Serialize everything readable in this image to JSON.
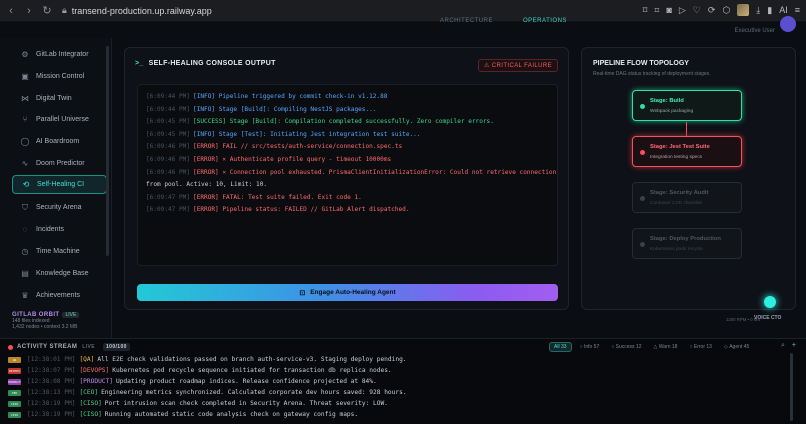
{
  "browser": {
    "url": "transend-production.up.railway.app",
    "ai_label": "AI"
  },
  "app_top": {
    "tabs": [
      "ARCHITECTURE",
      "OPERATIONS"
    ],
    "user_name": "Executive User"
  },
  "sidebar": {
    "items": [
      {
        "label": "GitLab Integrator",
        "icon": "grid-icon"
      },
      {
        "label": "Mission Control",
        "icon": "monitor-icon"
      },
      {
        "label": "Digital Twin",
        "icon": "share-icon"
      },
      {
        "label": "Parallel Universe",
        "icon": "branch-icon"
      },
      {
        "label": "AI Boardroom",
        "icon": "chat-icon"
      },
      {
        "label": "Doom Predictor",
        "icon": "pulse-icon"
      },
      {
        "label": "Self-Healing CI",
        "icon": "refresh-icon",
        "active": true
      },
      {
        "label": "Security Arena",
        "icon": "shield-icon"
      },
      {
        "label": "Incidents",
        "icon": "alert-icon"
      },
      {
        "label": "Time Machine",
        "icon": "clock-icon"
      },
      {
        "label": "Knowledge Base",
        "icon": "book-icon"
      },
      {
        "label": "Achievements",
        "icon": "trophy-icon"
      }
    ],
    "orbit_title": "GITLAB ORBIT",
    "orbit_badge": "LIVE",
    "orbit_files": "148 files indexed",
    "orbit_nodes": "1,432 nodes • context 3.2 MB"
  },
  "console": {
    "title": "SELF-HEALING CONSOLE OUTPUT",
    "badge": "CRITICAL FAILURE",
    "logs": [
      {
        "ts": "[6:09:44 PM]",
        "level": "[INFO]",
        "cls": "c-info",
        "msg": "Pipeline triggered by commit check-in v1.12.88"
      },
      {
        "ts": "[6:09:44 PM]",
        "level": "[INFO]",
        "cls": "c-info",
        "msg": "Stage [Build]: Compiling NestJS packages..."
      },
      {
        "ts": "[6:09:45 PM]",
        "level": "[SUCCESS]",
        "cls": "c-succ",
        "msg": "Stage [Build]: Compilation completed successfully. Zero compiler errors."
      },
      {
        "ts": "[6:09:45 PM]",
        "level": "[INFO]",
        "cls": "c-info",
        "msg": "Stage [Test]: Initiating Jest integration test suite..."
      },
      {
        "ts": "[6:09:46 PM]",
        "level": "[ERROR]",
        "cls": "c-err",
        "msg": "FAIL // src/tests/auth-service/connection.spec.ts"
      },
      {
        "ts": "[6:09:46 PM]",
        "level": "[ERROR]",
        "cls": "c-err",
        "msg": "✕ Authenticate profile query - timeout 10000ms"
      },
      {
        "ts": "[6:09:46 PM]",
        "level": "[ERROR]",
        "cls": "c-err",
        "msg": "✕ Connection pool exhausted. PrismaClientInitializationError: Could not retrieve connection"
      },
      {
        "ts": "",
        "level": "",
        "cls": "c-txt",
        "msg": "from pool. Active: 10, Limit: 10."
      },
      {
        "ts": "[6:09:47 PM]",
        "level": "[ERROR]",
        "cls": "c-err",
        "msg": "FATAL: Test suite failed. Exit code 1."
      },
      {
        "ts": "[6:09:47 PM]",
        "level": "[ERROR]",
        "cls": "c-err",
        "msg": "Pipeline status: FAILED // GitLab Alert dispatched."
      }
    ],
    "heal_button": "Engage Auto-Healing Agent"
  },
  "pipeline": {
    "title": "PIPELINE FLOW TOPOLOGY",
    "subtitle": "Real-time DAG status tracking of deployment stages.",
    "stages": [
      {
        "name": "Stage: Build",
        "desc": "Webpack packaging",
        "status": "ok"
      },
      {
        "name": "Stage: Jest Test Suite",
        "desc": "Integration testing specs",
        "status": "bad"
      },
      {
        "name": "Stage: Security Audit",
        "desc": "Container CVE checklist",
        "status": "idle"
      },
      {
        "name": "Stage: Deploy Production",
        "desc": "Kubernetes pods recycle",
        "status": "idle"
      }
    ],
    "voice_label": "VOICE CTO",
    "footer": "1200 RPM • 0 MS"
  },
  "activity": {
    "title": "ACTIVITY STREAM",
    "live": "LIVE",
    "count": "100/100",
    "filters": [
      "All",
      "Info",
      "Success",
      "Warn",
      "Error",
      "Agent"
    ],
    "rows": [
      {
        "tag": "QA",
        "color": "#b8872a",
        "ts": "[12:38:01 PM]",
        "src": "[QA]",
        "msg": "All E2E check validations passed on branch auth-service-v3. Staging deploy pending."
      },
      {
        "tag": "DEVOPS",
        "color": "#c0392b",
        "ts": "[12:38:07 PM]",
        "src": "[DEVOPS]",
        "msg": "Kubernetes pod recycle sequence initiated for transaction db replica nodes."
      },
      {
        "tag": "PRODUCT",
        "color": "#8e44ad",
        "ts": "[12:38:08 PM]",
        "src": "[PRODUCT]",
        "msg": "Updating product roadmap indices. Release confidence projected at 84%."
      },
      {
        "tag": "CEO",
        "color": "#2e8b57",
        "ts": "[12:38:13 PM]",
        "src": "[CEO]",
        "msg": "Engineering metrics synchronized. Calculated corporate dev hours saved: 928 hours."
      },
      {
        "tag": "CISO",
        "color": "#2e8b57",
        "ts": "[12:38:19 PM]",
        "src": "[CISO]",
        "msg": "Port intrusion scan check completed in Security Arena. Threat severity: LOW."
      },
      {
        "tag": "CISO",
        "color": "#2e8b57",
        "ts": "[12:38:19 PM]",
        "src": "[CISO]",
        "msg": "Running automated static code analysis check on gateway config maps."
      }
    ]
  },
  "colors": {
    "accent": "#3fe0cf",
    "error": "#ff4d5a",
    "success": "#2ee0a7"
  }
}
